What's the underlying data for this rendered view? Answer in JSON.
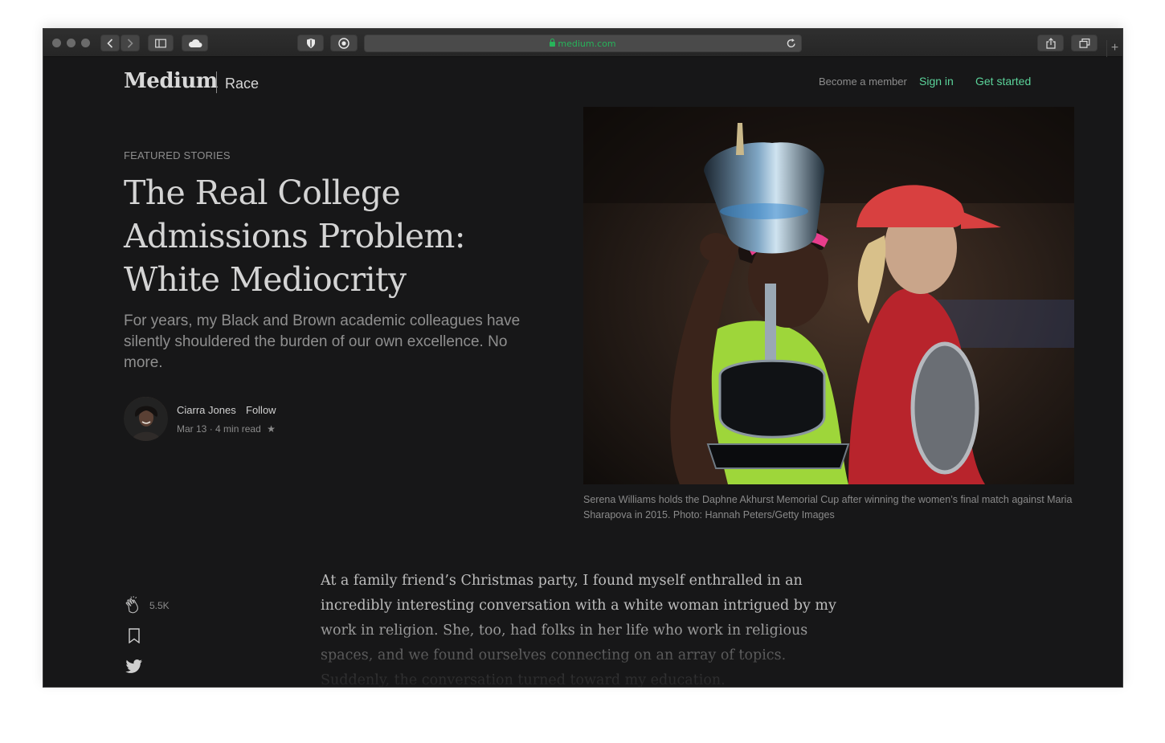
{
  "browser": {
    "url": "medium.com"
  },
  "site": {
    "logo": "Medium",
    "section": "Race"
  },
  "nav": {
    "member": "Become a member",
    "sign_in": "Sign in",
    "get_started": "Get started",
    "accent": "#5bd39a"
  },
  "article": {
    "kicker": "FEATURED STORIES",
    "title": "The Real College Admissions Problem: White Mediocrity",
    "subtitle": "For years, my Black and Brown academic colleagues have silently shouldered the burden of our own excellence. No more.",
    "author": "Ciarra Jones",
    "follow": "Follow",
    "date": "Mar 13",
    "read_time": "4 min read",
    "image_caption": "Serena Williams holds the Daphne Akhurst Memorial Cup after winning the women’s final match against Maria Sharapova in 2015. Photo: Hannah Peters/Getty Images",
    "body": "At a family friend’s Christmas party, I found myself enthralled in an incredibly interesting conversation with a white woman intrigued by my work in religion. She, too, had folks in her life who work in religious spaces, and we found ourselves connecting on an array of topics. Suddenly, the conversation turned toward my education."
  },
  "actions": {
    "claps": "5.5K"
  },
  "icons": [
    "back-icon",
    "forward-icon",
    "sidebar-icon",
    "cloud-icon",
    "shield-icon",
    "extension-icon",
    "lock-icon",
    "reload-icon",
    "share-icon",
    "tabs-icon",
    "plus-icon",
    "clap-icon",
    "bookmark-icon",
    "twitter-icon",
    "star-icon"
  ]
}
